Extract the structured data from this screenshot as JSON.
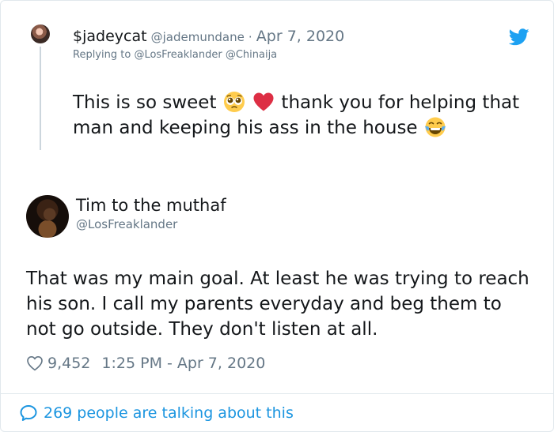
{
  "reply_tweet": {
    "display_name": "$jadeycat",
    "handle": "@jademundane",
    "separator": "·",
    "date": "Apr 7, 2020",
    "replying_to_prefix": "Replying to",
    "replying_to_users": [
      "@LosFreaklander",
      "@Chinaija"
    ],
    "text_part1": "This is so sweet",
    "text_part2": "thank you for helping that man and keeping his ass in the house",
    "emojis": [
      "pleading-face-emoji",
      "red-heart-emoji",
      "tears-of-joy-emoji"
    ]
  },
  "main_tweet": {
    "display_name": "Tim to the muthaf",
    "handle": "@LosFreaklander",
    "text": "That was my main goal. At least he was trying to reach his son. I call my parents everyday and beg them to not go outside. They don't listen at all.",
    "likes": "9,452",
    "timestamp": "1:25 PM - Apr 7, 2020"
  },
  "footer": {
    "talking_text": "269 people are talking about this"
  },
  "colors": {
    "twitter_blue": "#1da1f2",
    "link_blue": "#1b95e0",
    "muted_gray": "#657786",
    "heart_red": "#e0245e"
  },
  "icons": [
    "twitter-bird-icon",
    "heart-icon",
    "speech-bubble-icon"
  ]
}
